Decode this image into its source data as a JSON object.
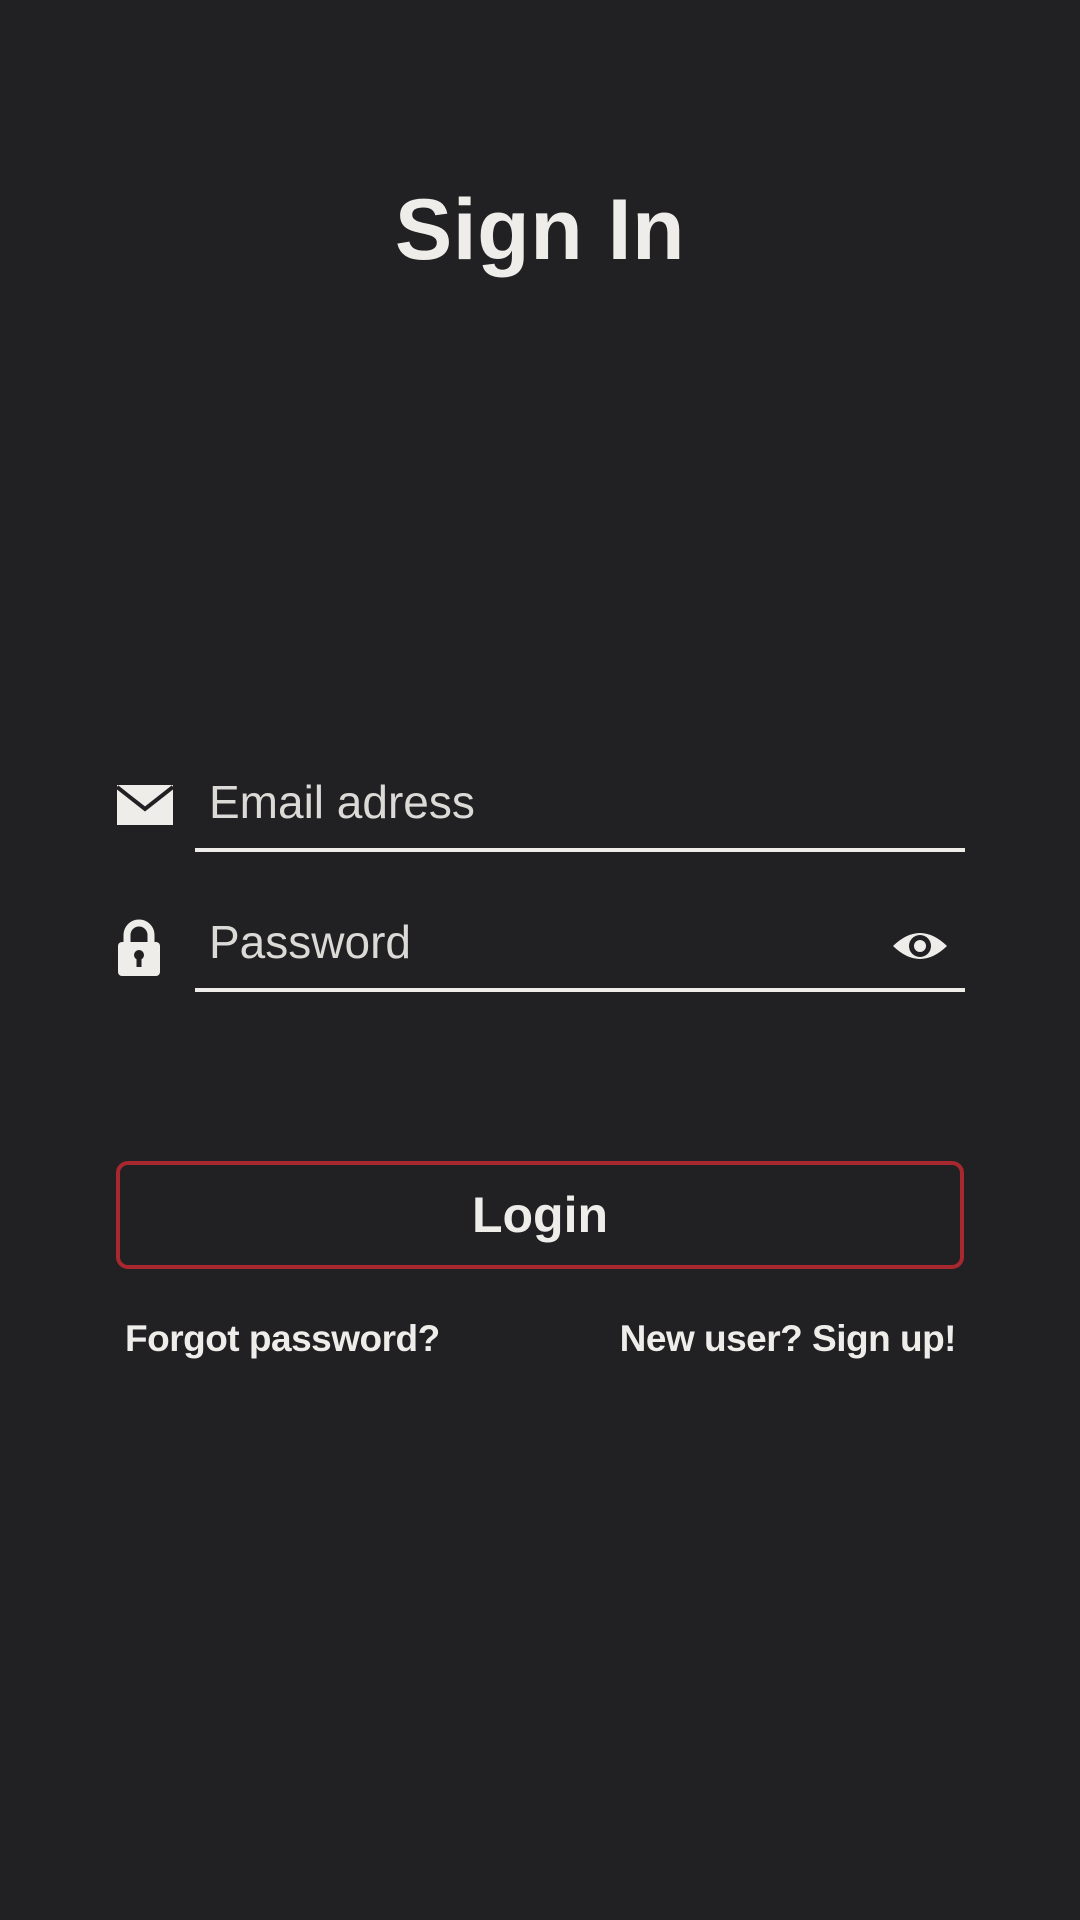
{
  "page": {
    "title": "Sign In"
  },
  "form": {
    "email": {
      "placeholder": "Email adress",
      "value": "",
      "icon": "mail-icon"
    },
    "password": {
      "placeholder": "Password",
      "value": "",
      "icon": "lock-icon",
      "toggle_icon": "eye-icon"
    },
    "login_label": "Login",
    "forgot_label": "Forgot password?",
    "signup_label": "New user? Sign up!"
  },
  "colors": {
    "background": "#212022",
    "text": "#efedea",
    "accent": "#a8282f"
  }
}
